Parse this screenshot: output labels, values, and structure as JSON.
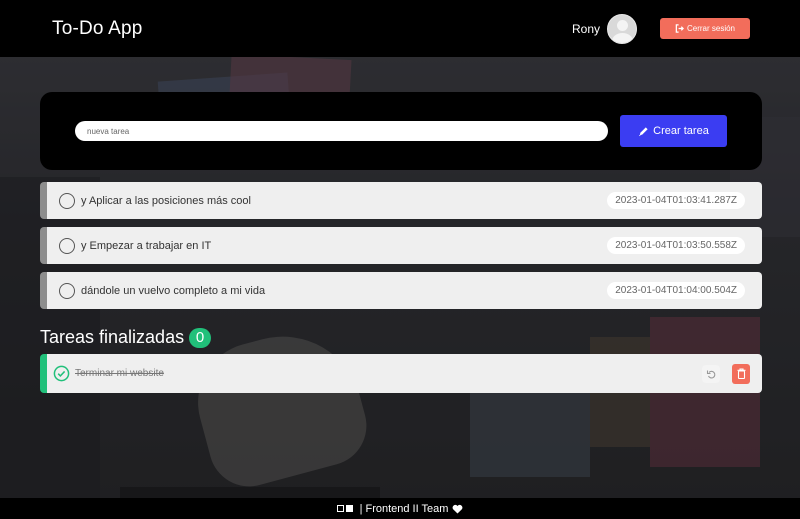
{
  "header": {
    "app_title": "To-Do App",
    "user_name": "Rony",
    "logout_label": "Cerrar sesión"
  },
  "new_task": {
    "placeholder": "nueva tarea",
    "create_label": "Crear tarea"
  },
  "pending_tasks": [
    {
      "description": "y Aplicar a las posiciones más cool",
      "created_at": "2023-01-04T01:03:41.287Z"
    },
    {
      "description": "y Empezar a trabajar en IT",
      "created_at": "2023-01-04T01:03:50.558Z"
    },
    {
      "description": "dándole un vuelvo completo a mi vida",
      "created_at": "2023-01-04T01:04:00.504Z"
    }
  ],
  "finished": {
    "title": "Tareas finalizadas",
    "count": "0",
    "tasks": [
      {
        "description": "Terminar mi website"
      }
    ]
  },
  "footer": {
    "text": "| Frontend II Team"
  },
  "colors": {
    "header_bg": "#000000",
    "accent_blue": "#3b3df2",
    "logout_red": "#f26d5b",
    "success_green": "#21c07a"
  },
  "icons": [
    "avatar-icon",
    "logout-icon",
    "pencil-icon",
    "check-circle-icon",
    "undo-icon",
    "trash-icon",
    "heart-icon",
    "dh-logo-icon"
  ]
}
